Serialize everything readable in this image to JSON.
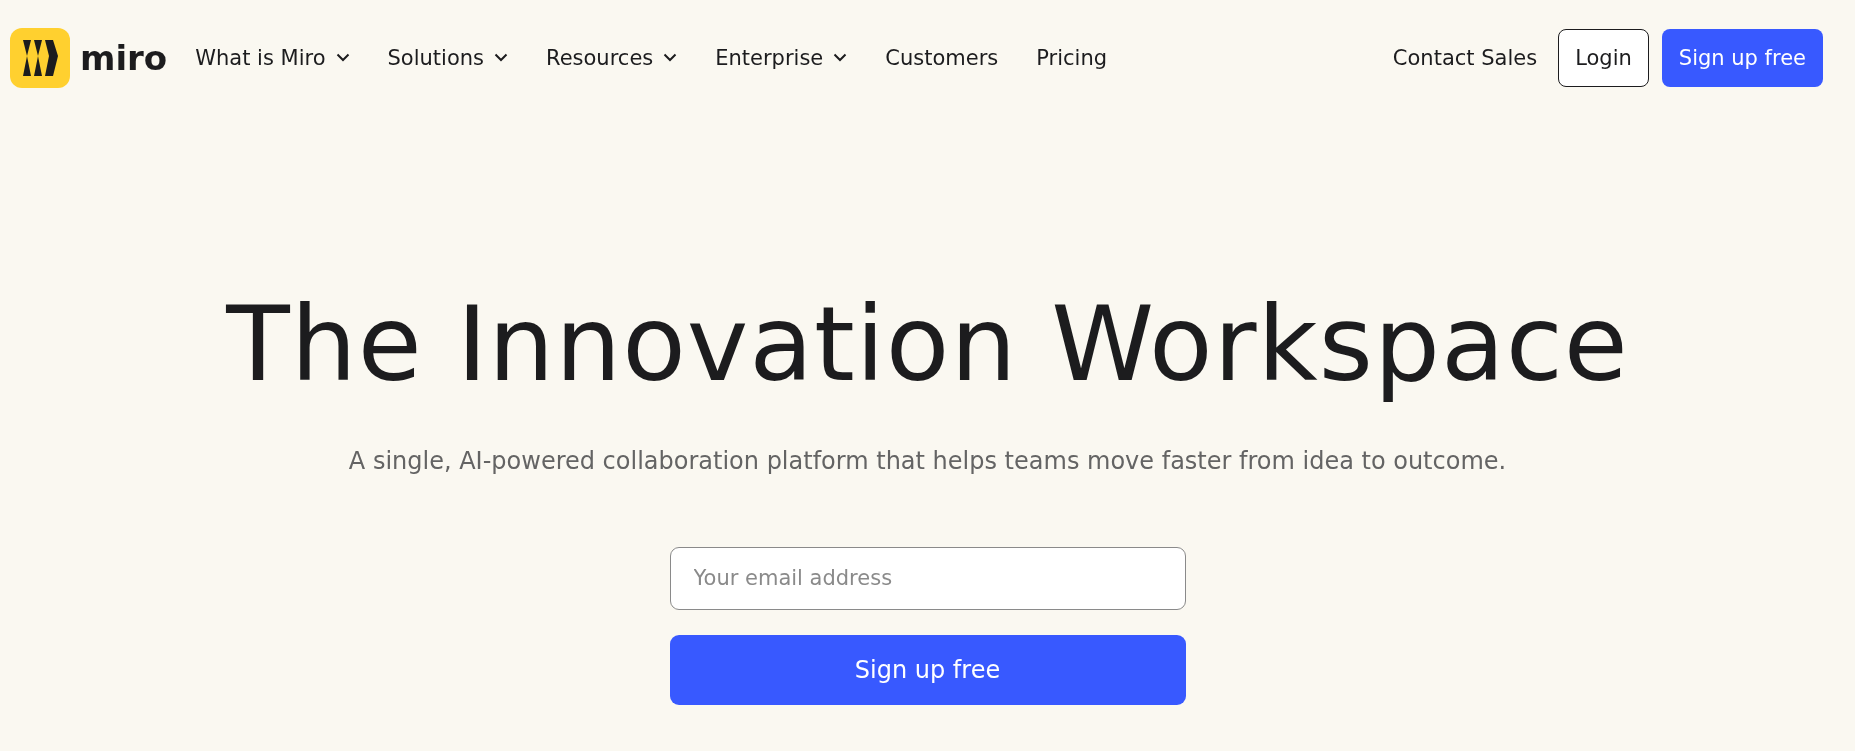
{
  "header": {
    "logo": {
      "text": "miro"
    },
    "nav": [
      {
        "label": "What is Miro",
        "dropdown": true
      },
      {
        "label": "Solutions",
        "dropdown": true
      },
      {
        "label": "Resources",
        "dropdown": true
      },
      {
        "label": "Enterprise",
        "dropdown": true
      },
      {
        "label": "Customers",
        "dropdown": false
      },
      {
        "label": "Pricing",
        "dropdown": false
      }
    ],
    "contact": "Contact Sales",
    "login": "Login",
    "signup": "Sign up free"
  },
  "hero": {
    "title": "The Innovation Workspace",
    "subtitle": "A single, AI-powered collaboration platform that helps teams move faster from idea to outcome.",
    "email": {
      "placeholder": "Your email address"
    },
    "button": "Sign up free"
  }
}
